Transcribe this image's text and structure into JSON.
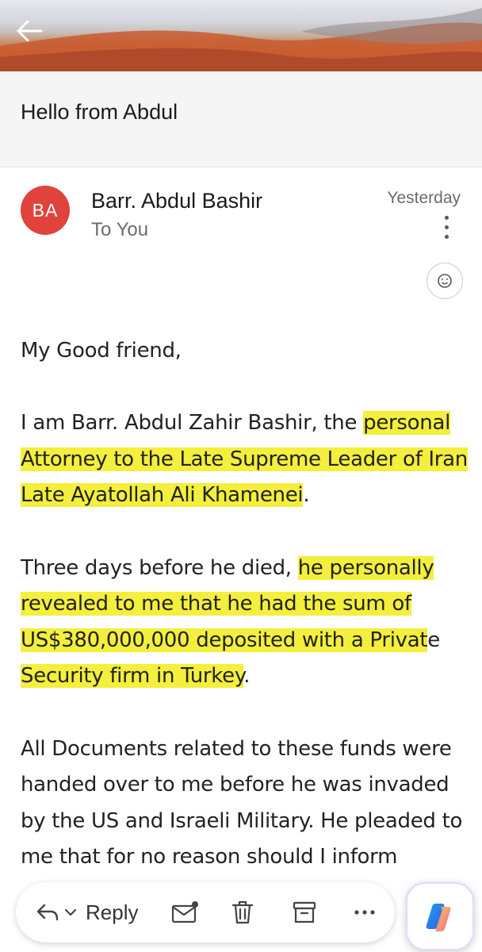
{
  "email": {
    "subject": "Hello from Abdul",
    "avatar_initials": "BA",
    "sender": "Barr. Abdul Bashir",
    "recipient": "To You",
    "date": "Yesterday",
    "avatar_color": "#e0433b"
  },
  "body": {
    "greeting": "My Good friend,",
    "p1_a": "I am Barr. Abdul Zahir Bashir, the ",
    "p1_b": "personal A",
    "p1_c": "ttorney to the Late Supreme Leader of Iran Late Ayatollah Ali Khamenei",
    "p1_d": ".",
    "p2_a": "Three days before he died, ",
    "p2_b": "he personally revealed to me that he had the sum of US$380,000,000 deposited with a Privat",
    "p2_c": "e ",
    "p2_d": "Security firm in Turkey",
    "p2_e": ".",
    "p3": "All Documents related to these funds were handed over to me before he was invaded by the US and Israeli Military. He pleaded to me that for no reason should I inform"
  },
  "toolbar": {
    "reply_label": "Reply",
    "icons": [
      "reply-icon",
      "chevron-down-icon",
      "mail-unread-icon",
      "trash-icon",
      "archive-icon",
      "more-icon",
      "copilot-icon"
    ]
  },
  "colors": {
    "highlight": "#f3ef3c",
    "header_orange": "#d2683a"
  }
}
